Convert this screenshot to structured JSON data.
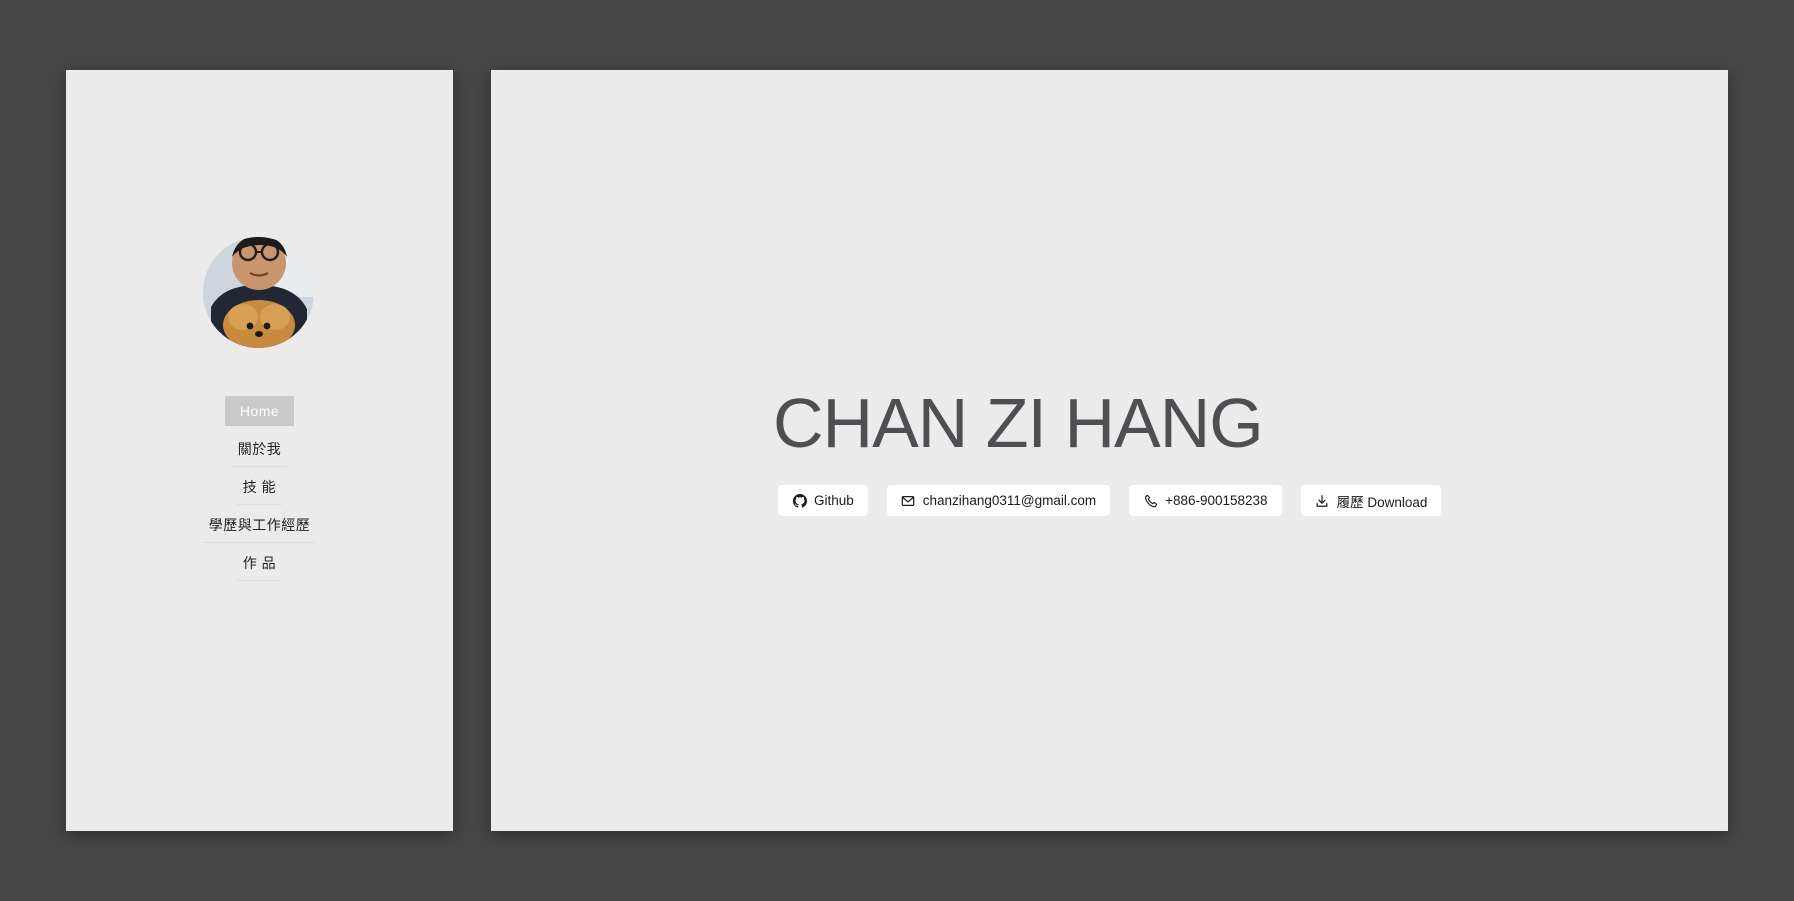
{
  "sidebar": {
    "avatar_alt": "profile photo",
    "nav": [
      {
        "label": "Home",
        "active": true
      },
      {
        "label": "關於我",
        "active": false
      },
      {
        "label": "技 能",
        "active": false
      },
      {
        "label": "學歷與工作經歷",
        "active": false
      },
      {
        "label": "作 品",
        "active": false
      }
    ]
  },
  "hero": {
    "name": "CHAN ZI HANG",
    "contacts": [
      {
        "icon": "github-icon",
        "label": "Github"
      },
      {
        "icon": "mail-icon",
        "label": "chanzihang0311@gmail.com"
      },
      {
        "icon": "phone-icon",
        "label": "+886-900158238"
      },
      {
        "icon": "download-icon",
        "label": "履歷 Download"
      }
    ]
  },
  "colors": {
    "background": "#464646",
    "panel": "#ebebeb",
    "active_nav": "#c9c9c9",
    "name_text": "#4e4f53"
  }
}
